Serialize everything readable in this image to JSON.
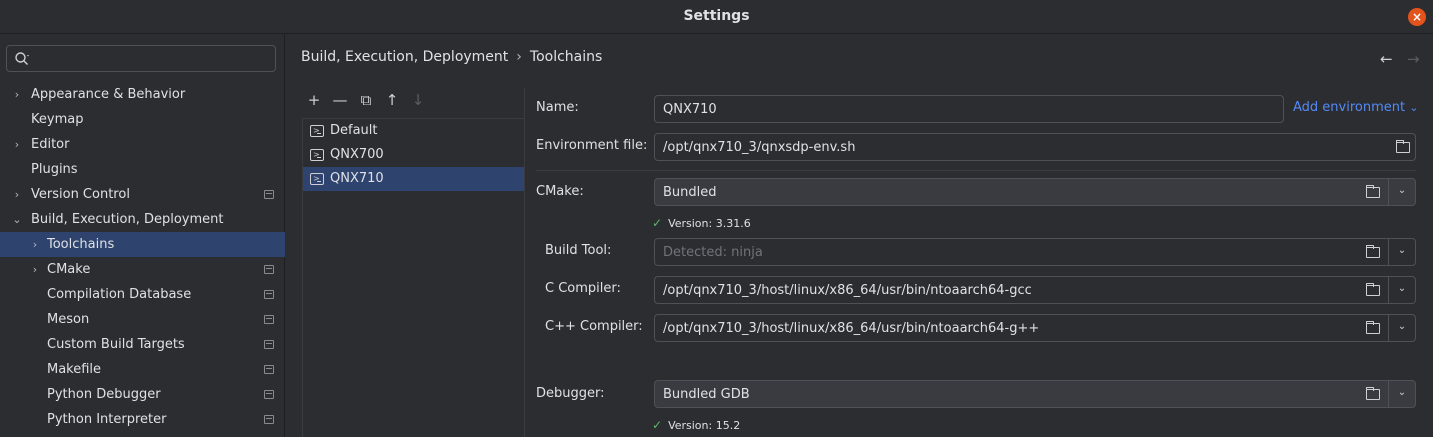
{
  "window": {
    "title": "Settings"
  },
  "sidebar": {
    "search": {
      "value": "",
      "placeholder": ""
    },
    "items": [
      {
        "label": "Appearance & Behavior",
        "indent": 0,
        "chevron": "›",
        "project": false,
        "selected": false
      },
      {
        "label": "Keymap",
        "indent": 0,
        "chevron": "",
        "project": false,
        "selected": false
      },
      {
        "label": "Editor",
        "indent": 0,
        "chevron": "›",
        "project": false,
        "selected": false
      },
      {
        "label": "Plugins",
        "indent": 0,
        "chevron": "",
        "project": false,
        "selected": false
      },
      {
        "label": "Version Control",
        "indent": 0,
        "chevron": "›",
        "project": true,
        "selected": false
      },
      {
        "label": "Build, Execution, Deployment",
        "indent": 0,
        "chevron": "⌄",
        "project": false,
        "selected": false
      },
      {
        "label": "Toolchains",
        "indent": 1,
        "chevron": "›",
        "project": false,
        "selected": true
      },
      {
        "label": "CMake",
        "indent": 1,
        "chevron": "›",
        "project": true,
        "selected": false
      },
      {
        "label": "Compilation Database",
        "indent": 1,
        "chevron": "",
        "project": true,
        "selected": false
      },
      {
        "label": "Meson",
        "indent": 1,
        "chevron": "",
        "project": true,
        "selected": false
      },
      {
        "label": "Custom Build Targets",
        "indent": 1,
        "chevron": "",
        "project": true,
        "selected": false
      },
      {
        "label": "Makefile",
        "indent": 1,
        "chevron": "",
        "project": true,
        "selected": false
      },
      {
        "label": "Python Debugger",
        "indent": 1,
        "chevron": "",
        "project": true,
        "selected": false
      },
      {
        "label": "Python Interpreter",
        "indent": 1,
        "chevron": "",
        "project": true,
        "selected": false
      }
    ]
  },
  "breadcrumb": {
    "parent": "Build, Execution, Deployment",
    "separator": "›",
    "current": "Toolchains"
  },
  "nav": {
    "back": "←",
    "forward": "→"
  },
  "toolbar": {
    "add": "+",
    "remove": "—",
    "copy": "⧉",
    "up": "↑",
    "down": "↓"
  },
  "toolchains": [
    {
      "name": "Default",
      "selected": false
    },
    {
      "name": "QNX700",
      "selected": false
    },
    {
      "name": "QNX710",
      "selected": true
    }
  ],
  "form": {
    "name": {
      "label": "Name:",
      "value": "QNX710"
    },
    "add_environment": "Add environment",
    "add_environment_chevron": "⌄",
    "env_file": {
      "label": "Environment file:",
      "value": "/opt/qnx710_3/qnxsdp-env.sh"
    },
    "cmake": {
      "label": "CMake:",
      "value": "Bundled",
      "version": "Version: 3.31.6"
    },
    "build_tool": {
      "label": "Build Tool:",
      "placeholder": "Detected: ninja"
    },
    "c_compiler": {
      "label": "C Compiler:",
      "value": "/opt/qnx710_3/host/linux/x86_64/usr/bin/ntoaarch64-gcc"
    },
    "cpp_compiler": {
      "label": "C++ Compiler:",
      "value": "/opt/qnx710_3/host/linux/x86_64/usr/bin/ntoaarch64-g++"
    },
    "debugger": {
      "label": "Debugger:",
      "value": "Bundled GDB",
      "version": "Version: 15.2"
    },
    "check_glyph": "✓",
    "dropdown_glyph": "⌄"
  },
  "colors": {
    "accent": "#548af7",
    "selection": "#2e436e",
    "success": "#5fb865",
    "close": "#e3541c"
  },
  "icons": {
    "close": "×"
  }
}
